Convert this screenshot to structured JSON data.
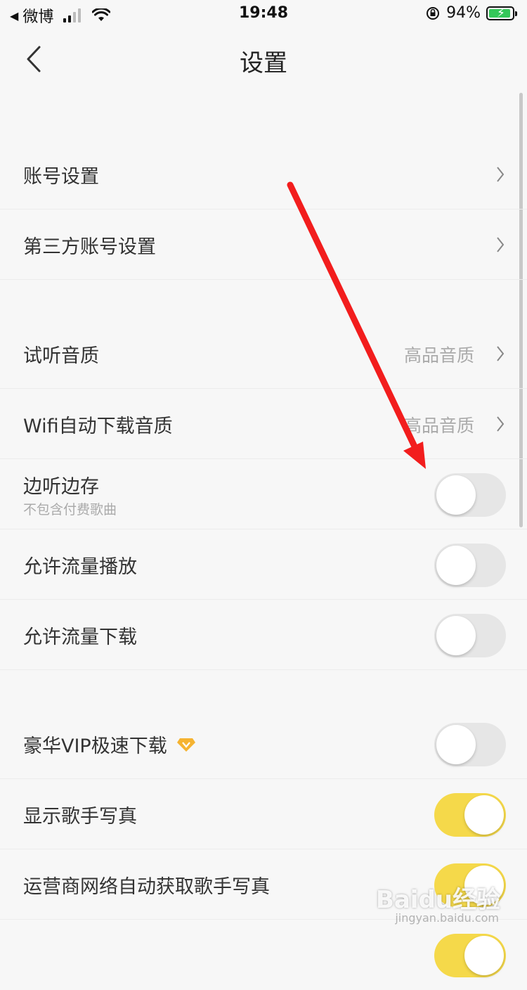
{
  "status_bar": {
    "carrier": "微博",
    "time": "19:48",
    "battery_percent": "94%",
    "battery_level": 0.94
  },
  "header": {
    "title": "设置"
  },
  "rows": [
    {
      "label": "账号设置"
    },
    {
      "label": "第三方账号设置"
    },
    {
      "label": "试听音质",
      "value": "高品音质"
    },
    {
      "label": "Wifi自动下载音质",
      "value": "高品音质"
    },
    {
      "label": "边听边存",
      "sub": "不包含付费歌曲",
      "toggle_on": false
    },
    {
      "label": "允许流量播放",
      "toggle_on": false
    },
    {
      "label": "允许流量下载",
      "toggle_on": false
    },
    {
      "label": "豪华VIP极速下载",
      "icon": "vip-diamond-icon",
      "toggle_on": false
    },
    {
      "label": "显示歌手写真",
      "toggle_on": true
    },
    {
      "label": "运营商网络自动获取歌手写真",
      "toggle_on": true
    }
  ],
  "watermark": {
    "brand": "Baidu经验",
    "url": "jingyan.baidu.com"
  },
  "colors": {
    "toggle_on": "#f5d94a",
    "toggle_off": "#e6e6e6",
    "annotation_arrow": "#f21d1d"
  }
}
